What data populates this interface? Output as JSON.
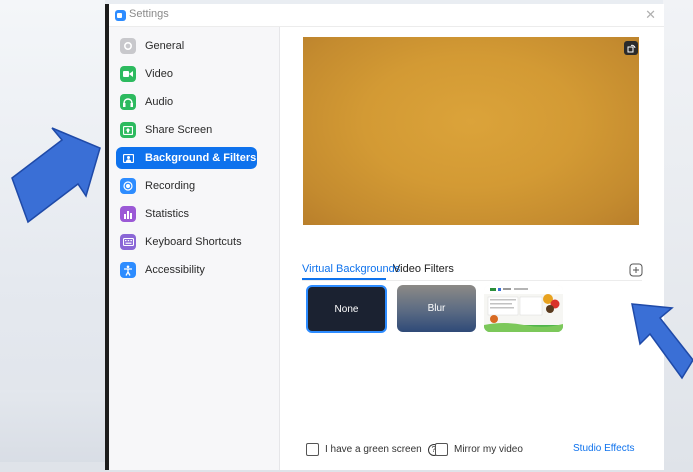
{
  "window": {
    "title": "Settings",
    "close_glyph": "✕"
  },
  "sidebar": {
    "items": [
      {
        "label": "General",
        "icon": "gear-icon",
        "color": "#c8c8cc"
      },
      {
        "label": "Video",
        "icon": "video-camera-icon",
        "color": "#2dba5f"
      },
      {
        "label": "Audio",
        "icon": "headphones-icon",
        "color": "#2dba5f"
      },
      {
        "label": "Share Screen",
        "icon": "share-screen-icon",
        "color": "#2dba5f"
      },
      {
        "label": "Background & Filters",
        "icon": "person-background-icon",
        "color": "#0e72ed",
        "active": true
      },
      {
        "label": "Recording",
        "icon": "record-icon",
        "color": "#2d8cff"
      },
      {
        "label": "Statistics",
        "icon": "bar-chart-icon",
        "color": "#9b59d6"
      },
      {
        "label": "Keyboard Shortcuts",
        "icon": "keyboard-icon",
        "color": "#8a66d6"
      },
      {
        "label": "Accessibility",
        "icon": "accessibility-icon",
        "color": "#2d8cff"
      }
    ]
  },
  "tabs": [
    {
      "label": "Virtual Backgrounds",
      "active": true
    },
    {
      "label": "Video Filters",
      "active": false
    }
  ],
  "backgrounds": [
    {
      "label": "None",
      "selected": true
    },
    {
      "label": "Blur",
      "selected": false
    },
    {
      "label": "",
      "selected": false
    }
  ],
  "footer": {
    "green_screen_label": "I have a green screen",
    "mirror_label": "Mirror my video",
    "studio_effects": "Studio Effects"
  },
  "colors": {
    "accent": "#0e72ed",
    "preview": "#d39a34"
  }
}
